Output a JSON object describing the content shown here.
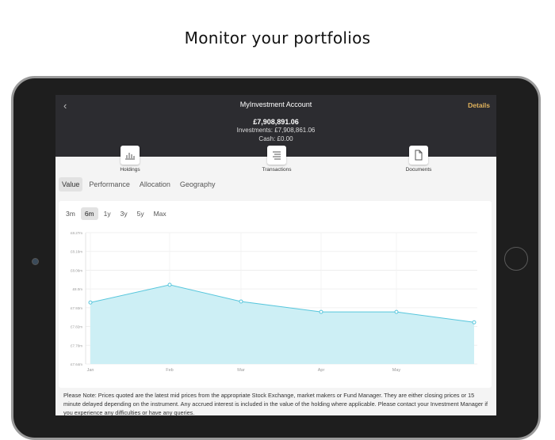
{
  "headline": "Monitor your portfolios",
  "header": {
    "back_icon": "chevron-left-icon",
    "title": "MyInvestment Account",
    "details_label": "Details",
    "total": "£7,908,891.06",
    "investments": "Investments: £7,908,861.06",
    "cash": "Cash: £0.00"
  },
  "actions": [
    {
      "label": "Holdings",
      "icon": "bar-chart-icon"
    },
    {
      "label": "Transactions",
      "icon": "list-lines-icon"
    },
    {
      "label": "Documents",
      "icon": "document-icon"
    }
  ],
  "tabs": [
    "Value",
    "Performance",
    "Allocation",
    "Geography"
  ],
  "active_tab": "Value",
  "ranges": [
    "3m",
    "6m",
    "1y",
    "3y",
    "5y",
    "Max"
  ],
  "active_range": "6m",
  "chart_data": {
    "type": "area",
    "x_labels": [
      "Jan",
      "Feb",
      "Mar",
      "Apr",
      "May"
    ],
    "y_tick_labels": [
      "£8.27m",
      "£8.16m",
      "£8.06m",
      "£8.0m",
      "£7.93m",
      "£7.82m",
      "£7.70m",
      "£7.64m"
    ],
    "points": [
      {
        "x": "Jan",
        "y": 7.935
      },
      {
        "x": "Feb",
        "y": 8.02
      },
      {
        "x": "Mar",
        "y": 7.94
      },
      {
        "x": "Apr",
        "y": 7.89
      },
      {
        "x": "May",
        "y": 7.89
      },
      {
        "x": "end",
        "y": 7.84
      }
    ],
    "fill_color": "#cdeff5",
    "line_color": "#57c6dc",
    "grid": true
  },
  "note": "Please Note: Prices quoted are the latest mid prices from the appropriate Stock Exchange, market makers or Fund Manager. They are either closing prices or 15 minute delayed depending on the instrument. Any accrued interest is included in the value of the holding where applicable. Please contact your Investment Manager if you experience any difficulties or have any queries."
}
